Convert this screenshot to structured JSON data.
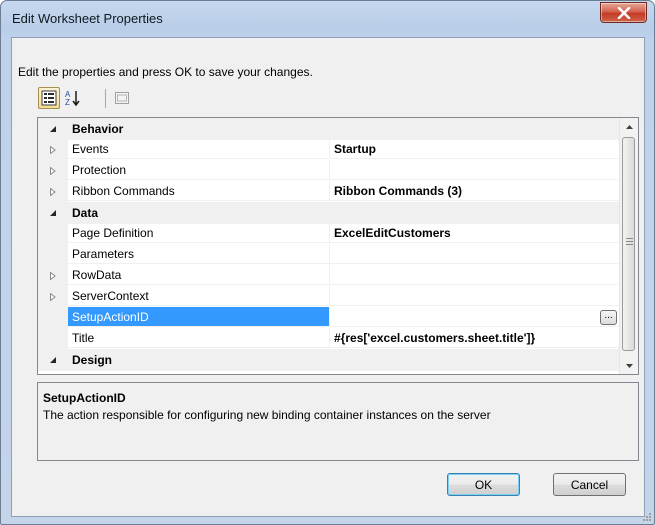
{
  "window": {
    "title": "Edit Worksheet Properties",
    "close_glyph": "✕"
  },
  "instruction": "Edit the properties and press OK to save your changes.",
  "toolbar": {
    "categorized_icon": "categorized-view-icon",
    "alphabetical_icon": "alphabetical-sort-icon",
    "property_pages_icon": "property-pages-icon"
  },
  "grid": {
    "rows": [
      {
        "type": "category",
        "name": "Behavior",
        "expanded": true
      },
      {
        "type": "property",
        "name": "Events",
        "value": "Startup",
        "expandable": true
      },
      {
        "type": "property",
        "name": "Protection",
        "value": "",
        "expandable": true
      },
      {
        "type": "property",
        "name": "Ribbon Commands",
        "value": "Ribbon Commands (3)",
        "expandable": true
      },
      {
        "type": "category",
        "name": "Data",
        "expanded": true
      },
      {
        "type": "property",
        "name": "Page Definition",
        "value": "ExcelEditCustomers",
        "expandable": false
      },
      {
        "type": "property",
        "name": "Parameters",
        "value": "",
        "expandable": false
      },
      {
        "type": "property",
        "name": "RowData",
        "value": "",
        "expandable": true
      },
      {
        "type": "property",
        "name": "ServerContext",
        "value": "",
        "expandable": true
      },
      {
        "type": "property",
        "name": "SetupActionID",
        "value": "",
        "expandable": false,
        "selected": true,
        "ellipsis": "..."
      },
      {
        "type": "property",
        "name": "Title",
        "value": "#{res['excel.customers.sheet.title']}",
        "expandable": false
      },
      {
        "type": "category",
        "name": "Design",
        "expanded": true
      }
    ]
  },
  "description": {
    "title": "SetupActionID",
    "text": "The action responsible for configuring new binding container instances on the server"
  },
  "buttons": {
    "ok": "OK",
    "cancel": "Cancel"
  },
  "colors": {
    "selection": "#3399ff",
    "close_button": "#c23b24",
    "title_bar": "#b9cde8"
  }
}
